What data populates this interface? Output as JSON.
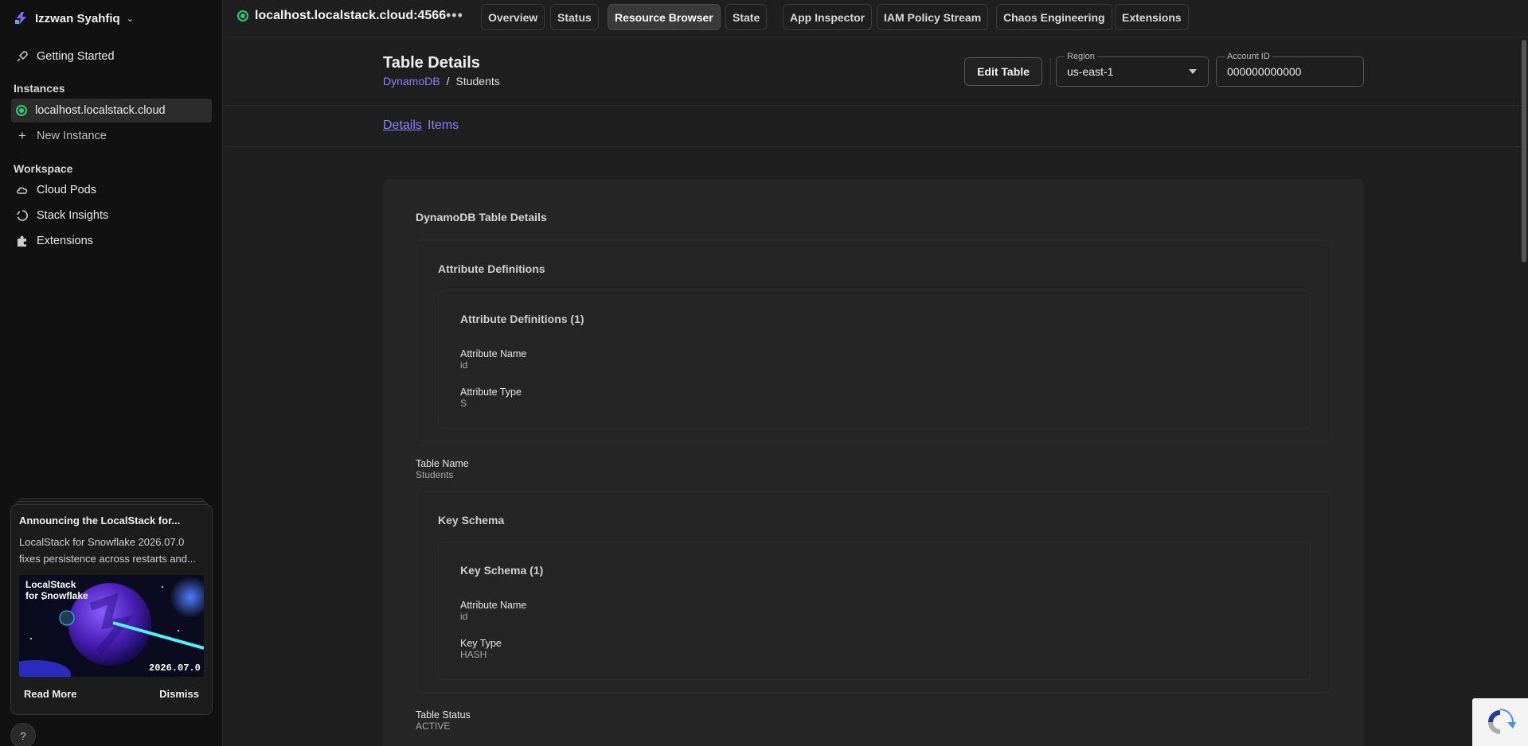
{
  "sidebar": {
    "user_name": "Izzwan Syahfiq",
    "getting_started": "Getting Started",
    "instances_title": "Instances",
    "instance_name": "localhost.localstack.cloud",
    "new_instance": "New Instance",
    "workspace_title": "Workspace",
    "workspace_items": [
      "Cloud Pods",
      "Stack Insights",
      "Extensions"
    ]
  },
  "announcement": {
    "title": "Announcing the LocalStack for...",
    "text": "LocalStack for Snowflake 2026.07.0 fixes persistence across restarts and...",
    "image_title_line1": "LocalStack",
    "image_title_line2": "for Snowflake",
    "image_version": "2026.07.0",
    "read_more": "Read More",
    "dismiss": "Dismiss"
  },
  "help_label": "?",
  "topbar": {
    "host": "localhost.localstack.cloud:4566",
    "tabs": [
      "Overview",
      "Status",
      "Resource Browser",
      "State",
      "App Inspector",
      "IAM Policy Stream",
      "Chaos Engineering",
      "Extensions"
    ],
    "active_tab": "Resource Browser"
  },
  "header": {
    "title": "Table Details",
    "breadcrumb_root": "DynamoDB",
    "breadcrumb_sep": "/",
    "breadcrumb_current": "Students",
    "edit_button": "Edit Table",
    "region_label": "Region",
    "region_value": "us-east-1",
    "account_label": "Account ID",
    "account_value": "000000000000"
  },
  "subtabs": {
    "details": "Details",
    "items": "Items"
  },
  "details": {
    "panel_title": "DynamoDB Table Details",
    "attr_defs_title": "Attribute Definitions",
    "attr_defs_inner_title": "Attribute Definitions (1)",
    "attr_name_label": "Attribute Name",
    "attr_name_value": "id",
    "attr_type_label": "Attribute Type",
    "attr_type_value": "S",
    "table_name_label": "Table Name",
    "table_name_value": "Students",
    "key_schema_title": "Key Schema",
    "key_schema_inner_title": "Key Schema (1)",
    "ks_attr_name_label": "Attribute Name",
    "ks_attr_name_value": "id",
    "key_type_label": "Key Type",
    "key_type_value": "HASH",
    "table_status_label": "Table Status",
    "table_status_value": "ACTIVE"
  }
}
